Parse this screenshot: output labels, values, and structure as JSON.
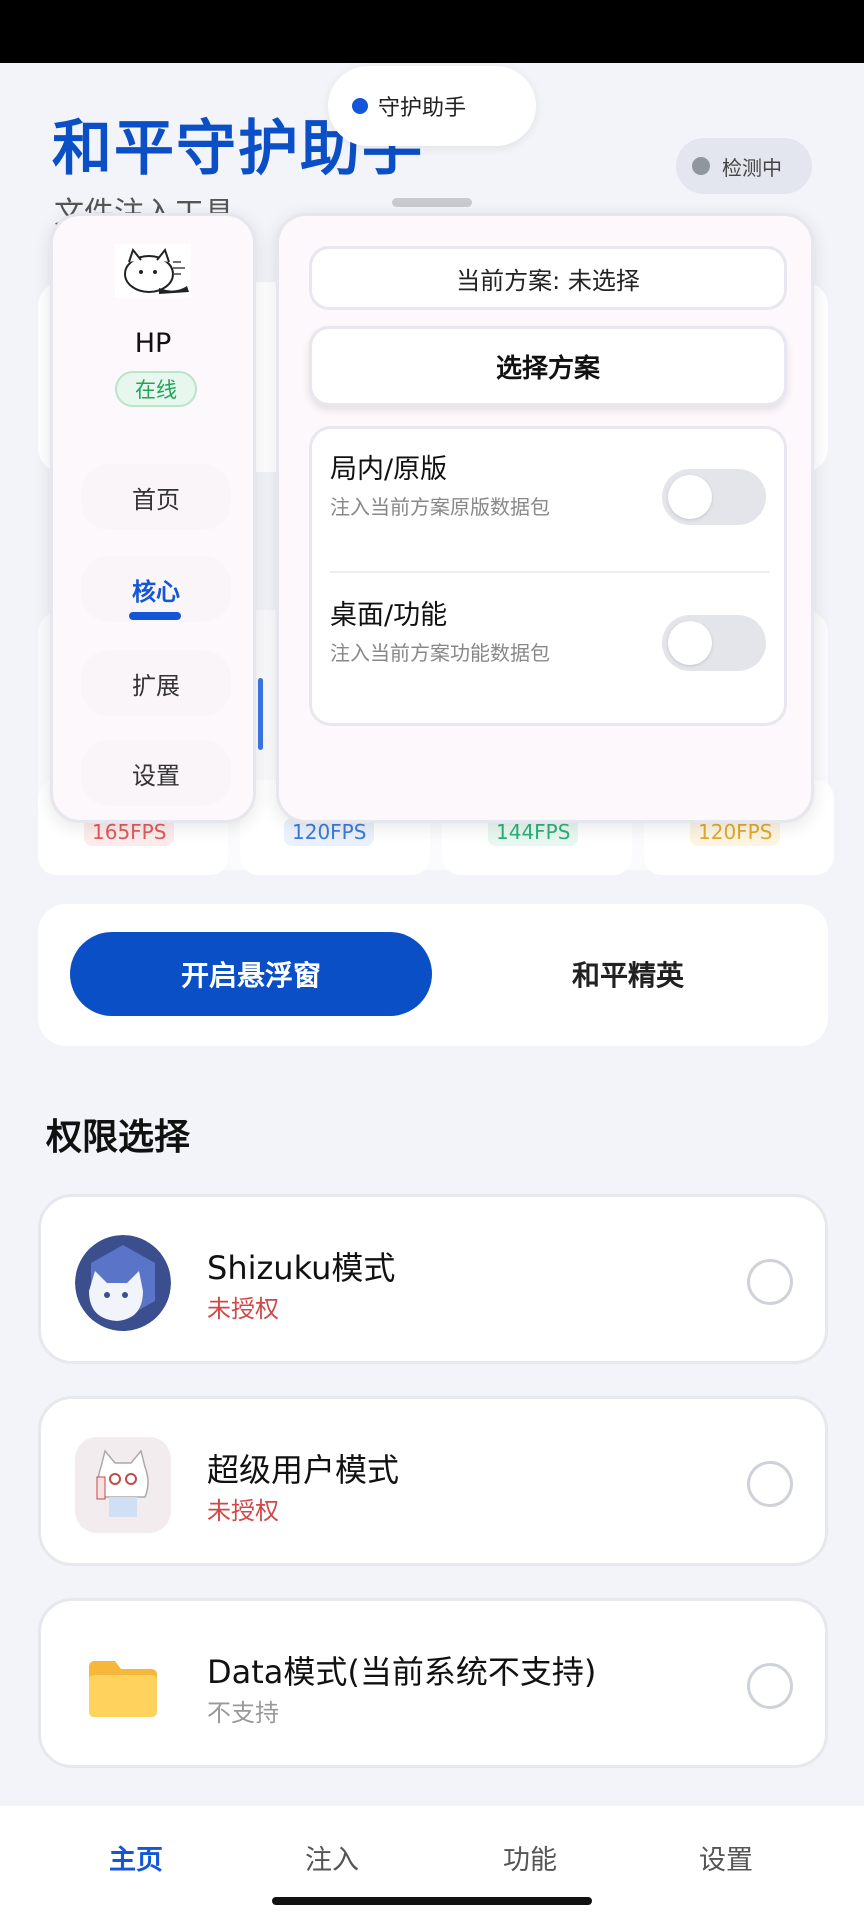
{
  "header": {
    "title": "和平守护助手",
    "subtitle": "文件注入工具",
    "helper_pill": "守护助手",
    "detect_pill": "检测中"
  },
  "background": {
    "fps": [
      "165FPS",
      "120FPS",
      "144FPS",
      "120FPS"
    ]
  },
  "side_panel": {
    "user_name": "HP",
    "status": "在线",
    "nav": [
      "首页",
      "核心",
      "扩展",
      "设置"
    ],
    "active_index": 1
  },
  "main_panel": {
    "current_scheme": "当前方案: 未选择",
    "choose_scheme": "选择方案",
    "toggles": [
      {
        "title": "局内/原版",
        "desc": "注入当前方案原版数据包",
        "on": false
      },
      {
        "title": "桌面/功能",
        "desc": "注入当前方案功能数据包",
        "on": false
      }
    ]
  },
  "actions": {
    "float_window": "开启悬浮窗",
    "elite": "和平精英"
  },
  "permissions": {
    "title": "权限选择",
    "items": [
      {
        "name": "Shizuku模式",
        "status": "未授权",
        "status_color": "#d04848",
        "icon": "shizuku-icon"
      },
      {
        "name": "超级用户模式",
        "status": "未授权",
        "status_color": "#d04848",
        "icon": "superuser-avatar-icon"
      },
      {
        "name": "Data模式(当前系统不支持)",
        "status": "不支持",
        "status_color": "#999999",
        "icon": "folder-icon"
      }
    ]
  },
  "bottom_nav": {
    "items": [
      "主页",
      "注入",
      "功能",
      "设置"
    ],
    "active_index": 0
  },
  "colors": {
    "accent": "#0b4fc6",
    "online": "#22a55a",
    "warn": "#d04848"
  }
}
